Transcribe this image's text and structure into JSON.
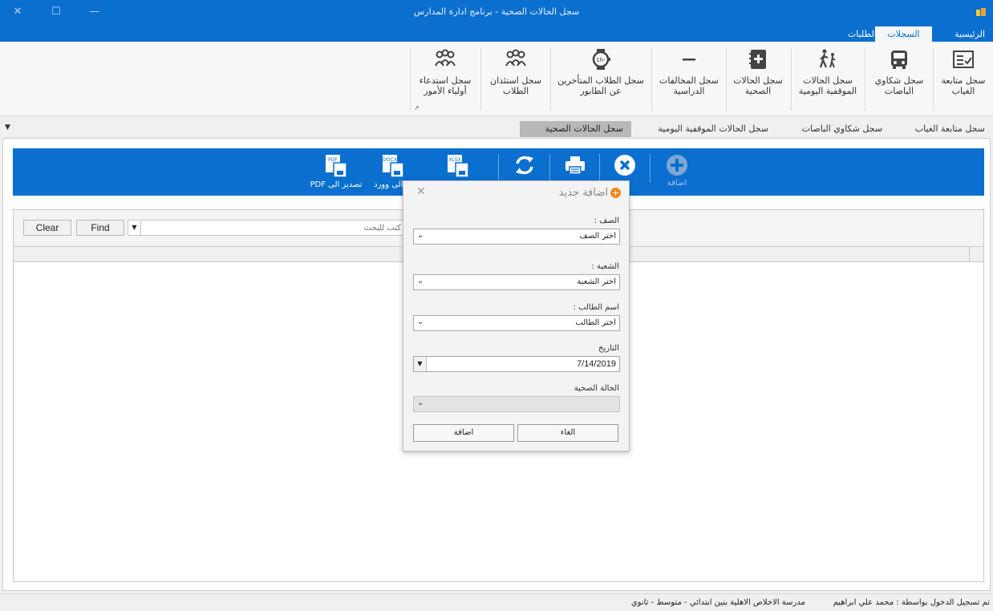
{
  "window": {
    "title": "سجل الحالات الصحية - برنامج ادارة المدارس",
    "close_glyph": "✕",
    "maximize_glyph": "☐",
    "minimize_glyph": "—"
  },
  "ribbon_tabs": [
    {
      "label": "الرئيسية"
    },
    {
      "label": "السجلات",
      "active": true
    },
    {
      "label": "الطلبات"
    }
  ],
  "ribbon": {
    "buttons": [
      {
        "label": "سجل متابعة الغياب",
        "icon": "checklist-icon"
      },
      {
        "label": "سجل شكاوي الباصات",
        "icon": "bus-icon"
      },
      {
        "label": "سجل الحالات الموقفية اليومية",
        "icon": "walking-people-icon"
      },
      {
        "label": "سجل الحالات الصحية",
        "icon": "medical-notebook-icon"
      },
      {
        "label": "سجل المخالفات الدراسية",
        "icon": "minus-icon"
      },
      {
        "label": "سجل الطلاب المتأخرين عن الطابور",
        "icon": "late-watch-icon"
      },
      {
        "label": "سجل استئذان الطلاب",
        "icon": "people-group-icon"
      },
      {
        "label": "سجل استدعاء أولياء الأمور",
        "icon": "parents-group-icon"
      }
    ]
  },
  "doc_tabs": [
    {
      "label": "سجل متابعة الغياب"
    },
    {
      "label": "سجل شكاوي الباصات"
    },
    {
      "label": "سجل الحالات الموقفية اليومية"
    },
    {
      "label": "سجل الحالات الصحية",
      "active": true,
      "close": "✕"
    }
  ],
  "toolbar": {
    "add_label": "اضافة",
    "export_pdf_label": "تصدير الى PDF",
    "export_word_label": "ير الى وورد",
    "docx_badge": "DOCX",
    "xlsx_badge": "XLSX",
    "pdf_badge": "PDF"
  },
  "findbar": {
    "clear_label": "Clear",
    "find_label": "Find",
    "search_placeholder": "كتب للبحث"
  },
  "dialog": {
    "title": "اضافة جديد",
    "grade_label": "الصف :",
    "grade_value": "اختر الصف",
    "section_label": "الشعبة :",
    "section_value": "اختر الشعبة",
    "student_label": "اسم الطالب :",
    "student_value": "اختر الطالب",
    "date_label": "التاريخ",
    "date_value": "7/14/2019",
    "health_label": "الحالة الصحية",
    "health_value": "",
    "cancel_label": "الغاء",
    "add_label": "اضافة"
  },
  "statusbar": {
    "logged_in": "تم تسجيل الدخول بواسطة : محمد علي ابراهيم",
    "school": "مدرسة الاخلاص الاهلية بنين  ابتدائي - متوسط - ثانوي"
  },
  "colors": {
    "accent": "#0a6fcf",
    "dialog_icon": "#f08a1c"
  }
}
